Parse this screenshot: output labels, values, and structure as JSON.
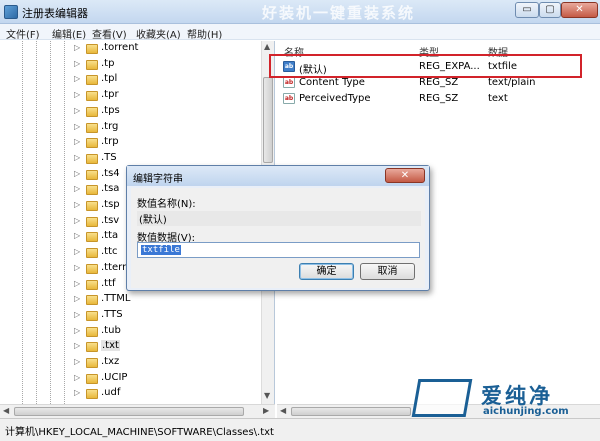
{
  "window": {
    "title": "注册表编辑器",
    "overlay_text": "好装机一键重装系统",
    "min_label": "▭",
    "max_label": "▢",
    "close_label": "✕"
  },
  "menu": [
    "文件(F)",
    "编辑(E)",
    "查看(V)",
    "收藏夹(A)",
    "帮助(H)"
  ],
  "tree": {
    "items": [
      ".torrent",
      ".tp",
      ".tpl",
      ".tpr",
      ".tps",
      ".trg",
      ".trp",
      ".TS",
      ".ts4",
      ".tsa",
      ".tsp",
      ".tsv",
      ".tta",
      ".ttc",
      ".tterm",
      ".ttf",
      ".TTML",
      ".TTS",
      ".tub",
      ".txt",
      ".txz",
      ".UCIP",
      ".udf"
    ],
    "selected": ".txt"
  },
  "list": {
    "headers": {
      "name": "名称",
      "type": "类型",
      "data": "数据"
    },
    "rows": [
      {
        "name": "(默认)",
        "type": "REG_EXPA...",
        "data": "txtfile",
        "icon": "default-value-icon"
      },
      {
        "name": "Content Type",
        "type": "REG_SZ",
        "data": "text/plain",
        "icon": "string-value-icon"
      },
      {
        "name": "PerceivedType",
        "type": "REG_SZ",
        "data": "text",
        "icon": "string-value-icon"
      }
    ]
  },
  "dialog": {
    "title": "编辑字符串",
    "close_label": "✕",
    "name_label": "数值名称(N):",
    "name_value": "(默认)",
    "data_label": "数值数据(V):",
    "data_value": "txtfile",
    "ok_label": "确定",
    "cancel_label": "取消"
  },
  "status": {
    "path": "计算机\\HKEY_LOCAL_MACHINE\\SOFTWARE\\Classes\\.txt"
  },
  "watermark": {
    "brand": "爱纯净",
    "url": "aichunjing.com"
  },
  "colors": {
    "highlight_box": "#d2232a",
    "selection": "#3a78d6",
    "watermark": "#1a5f95"
  }
}
